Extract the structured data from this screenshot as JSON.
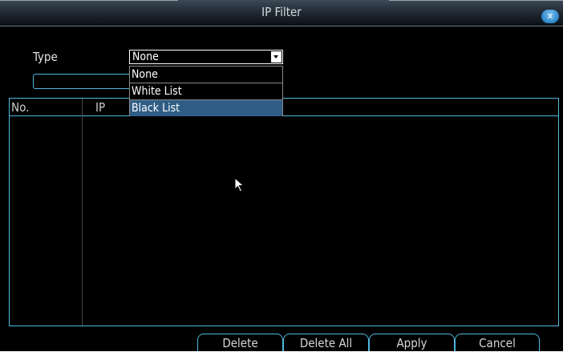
{
  "window": {
    "title": "IP Filter",
    "close_icon": "close-icon"
  },
  "form": {
    "type_label": "Type",
    "type_value": "None",
    "ip_input_value": ""
  },
  "dropdown": {
    "options": [
      "None",
      "White List",
      "Black List"
    ],
    "highlighted": "Black List"
  },
  "table": {
    "columns": [
      "No.",
      "IP"
    ],
    "rows": []
  },
  "buttons": {
    "delete": "Delete",
    "delete_all": "Delete All",
    "apply": "Apply",
    "cancel": "Cancel"
  },
  "colors": {
    "accent": "#4fb9df",
    "title_text": "#d4dbe2",
    "highlight": "#2f5d86"
  }
}
